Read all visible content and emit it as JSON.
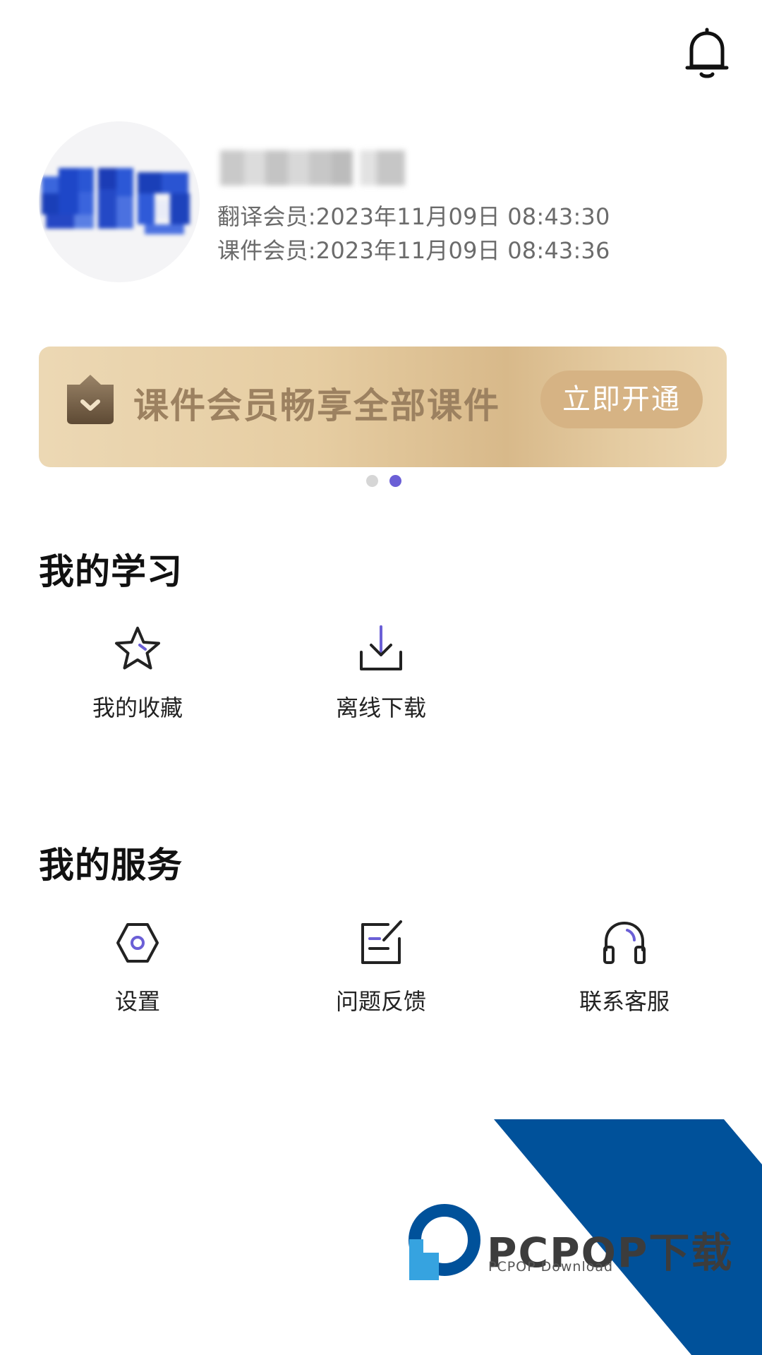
{
  "header": {
    "bell_icon": "bell-icon"
  },
  "profile": {
    "avatar_icon": "avatar-pixelated",
    "translation_member": "翻译会员:2023年11月09日 08:43:30",
    "course_member": "课件会员:2023年11月09日 08:43:36"
  },
  "banner": {
    "icon": "shield-check-icon",
    "text": "课件会员畅享全部课件",
    "button_label": "立即开通",
    "page_index": 2,
    "page_count": 2
  },
  "my_learning": {
    "title": "我的学习",
    "items": [
      {
        "label": "我的收藏",
        "icon": "star-icon"
      },
      {
        "label": "离线下载",
        "icon": "download-icon"
      }
    ]
  },
  "my_services": {
    "title": "我的服务",
    "items": [
      {
        "label": "设置",
        "icon": "settings-icon"
      },
      {
        "label": "问题反馈",
        "icon": "feedback-icon"
      },
      {
        "label": "联系客服",
        "icon": "headset-icon"
      }
    ]
  },
  "watermark": {
    "brand": "PCPOP下载",
    "subtitle": "PCPOP Download"
  },
  "colors": {
    "accent": "#6b5fd6",
    "banner_gold": "#d8b98a",
    "banner_text": "#9c8160",
    "dot_inactive": "#d6d6d6",
    "watermark_blue": "#00519a",
    "watermark_light_blue": "#36a3e0"
  }
}
